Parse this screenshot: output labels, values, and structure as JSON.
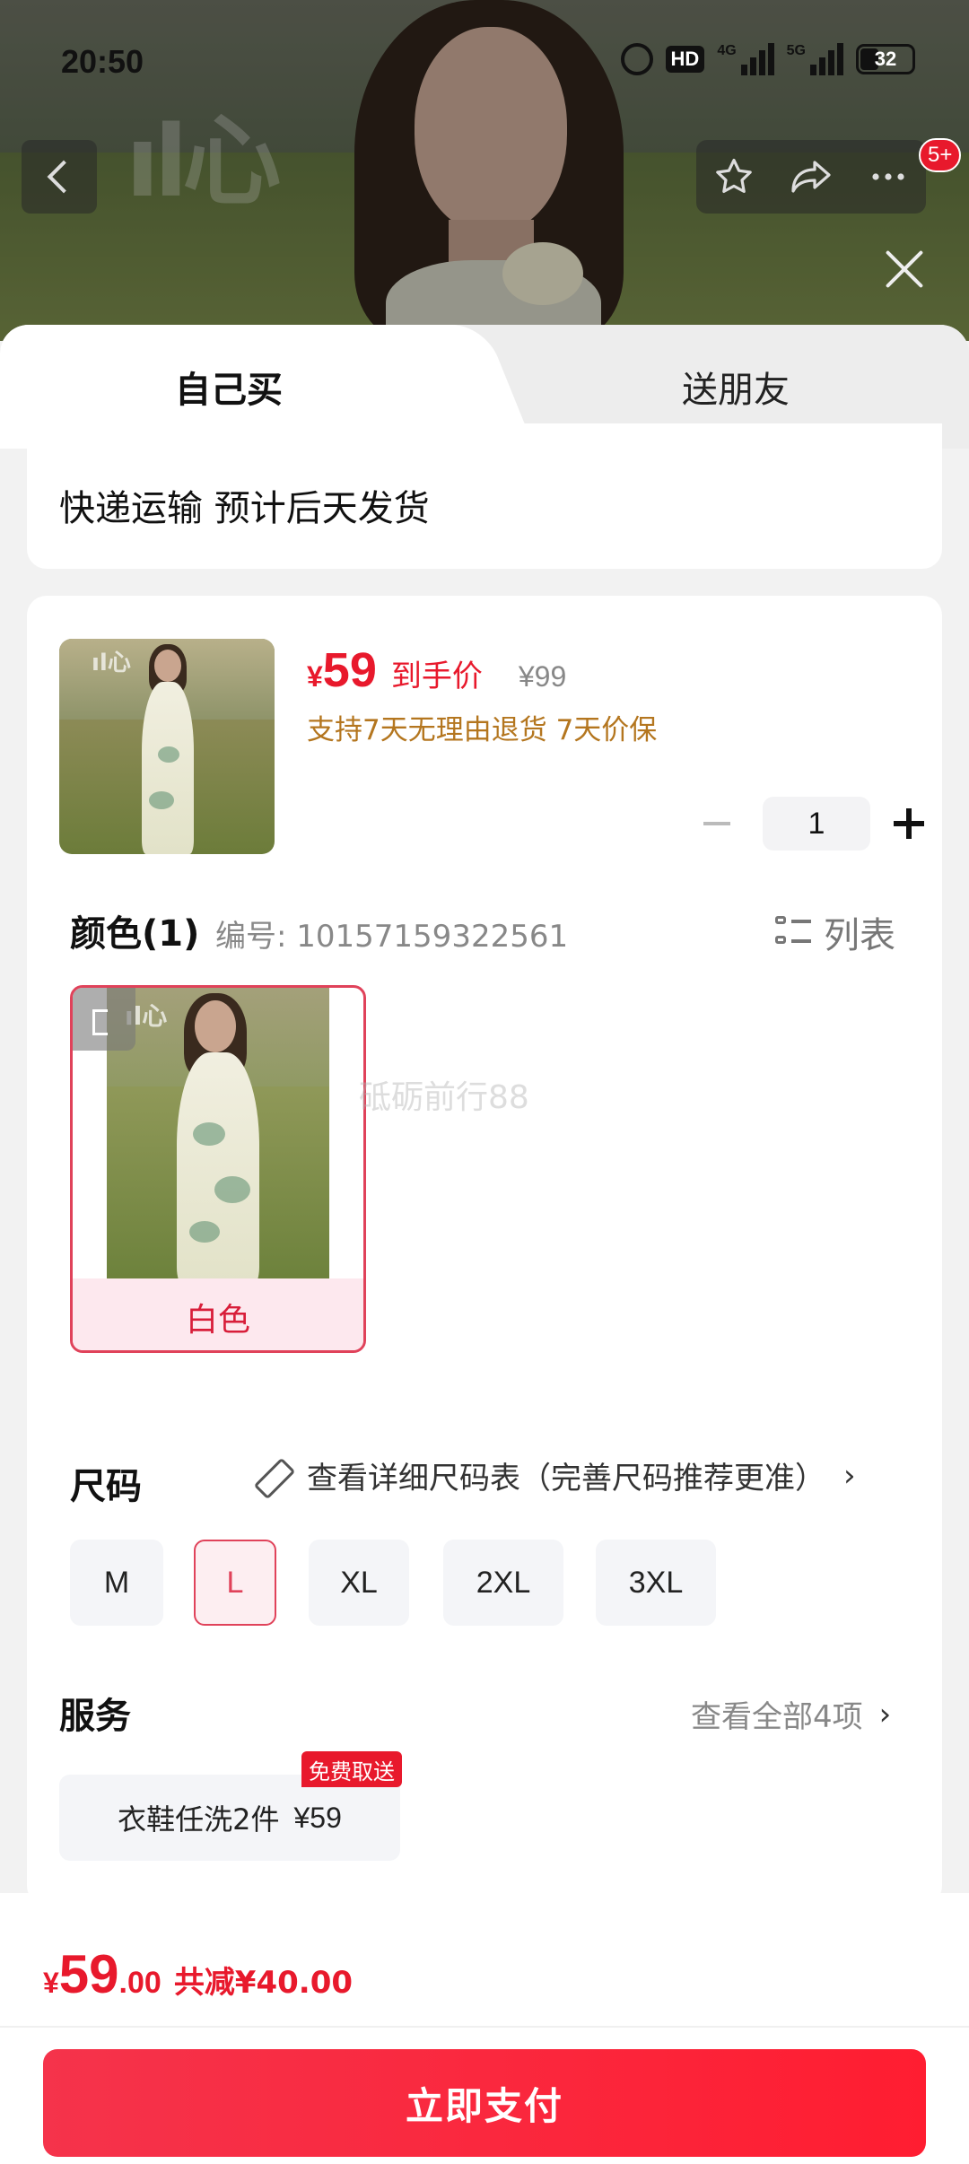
{
  "status_bar": {
    "time": "20:50",
    "hd": "HD",
    "network_1": "4G",
    "network_2": "5G",
    "battery": "32"
  },
  "top_bar": {
    "badge_count": "5+"
  },
  "tabs": {
    "self": "自己买",
    "gift": "送朋友"
  },
  "shipping": {
    "text": "快递运输 预计后天发货"
  },
  "product": {
    "currency": "¥",
    "price": "59",
    "price_tag": "到手价",
    "original_price": "¥99",
    "guarantee": "支持7天无理由退货  7天价保",
    "quantity": "1"
  },
  "color": {
    "title": "颜色(1)",
    "code": "编号: 10157159322561",
    "list_label": "列表",
    "selected_name": "白色"
  },
  "size": {
    "title": "尺码",
    "chart_link": "查看详细尺码表（完善尺码推荐更准）",
    "chevron": "›",
    "options": [
      "M",
      "L",
      "XL",
      "2XL",
      "3XL"
    ],
    "selected": "L"
  },
  "service": {
    "title": "服务",
    "view_all": "查看全部4项",
    "chevron": "›",
    "chip_label": "衣鞋任洗2件",
    "chip_price": "¥59",
    "chip_badge": "免费取送"
  },
  "footer": {
    "currency": "¥",
    "total_int": "59",
    "total_dec": ".00",
    "discount": "共减¥40.00",
    "pay_button": "立即支付"
  },
  "colors": {
    "accent": "#e8192c",
    "guarantee": "#b4761f",
    "selected_bg": "#fdeef1"
  }
}
